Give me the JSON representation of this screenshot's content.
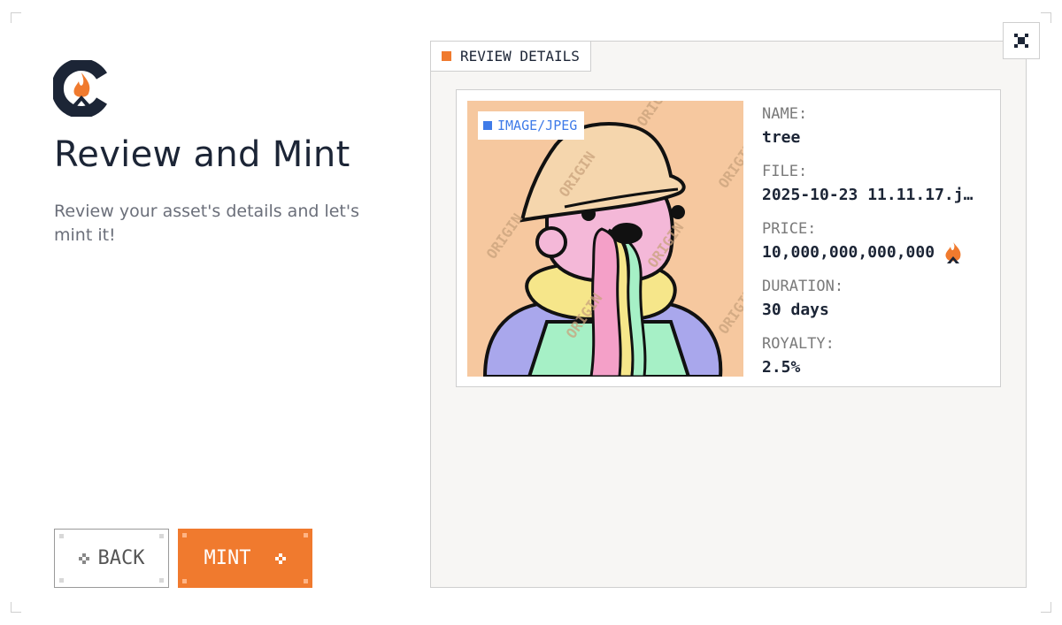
{
  "header": {
    "title": "Review and Mint",
    "subtitle": "Review your asset's details and let's mint it!"
  },
  "buttons": {
    "back_label": "BACK",
    "mint_label": "MINT"
  },
  "panel": {
    "tab_label": "REVIEW DETAILS",
    "media_type": "IMAGE/JPEG",
    "watermark_text": "ORIGIN",
    "details": {
      "name_label": "NAME:",
      "name_value": "tree",
      "file_label": "FILE:",
      "file_value": "2025-10-23 11.11.17.j…",
      "price_label": "PRICE:",
      "price_value": "10,000,000,000,000",
      "duration_label": "DURATION:",
      "duration_value": "30 days",
      "royalty_label": "ROYALTY:",
      "royalty_value": "2.5%"
    }
  },
  "icons": {
    "logo": "brand-logo",
    "expand": "expand-icon",
    "price_currency": "flame-icon",
    "back_arrow": "pixel-arrow-left-icon",
    "mint_arrow": "pixel-arrow-right-icon"
  },
  "colors": {
    "accent": "#f07a2e",
    "media_badge": "#3f7be8",
    "text_dark": "#1c2536",
    "text_muted": "#7a7a7a",
    "panel_bg": "#f7f6f4"
  }
}
